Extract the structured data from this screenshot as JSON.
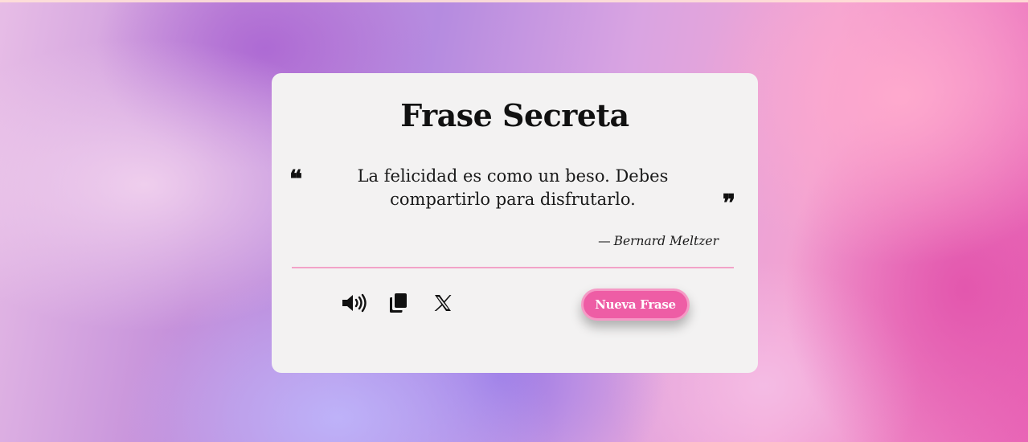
{
  "card": {
    "title": "Frase Secreta",
    "quote_open": "❝",
    "quote_text": "La felicidad es como un beso. Debes compartirlo para disfrutarlo.",
    "quote_close": "❞",
    "author_dash": "—",
    "author": "Bernard Meltzer"
  },
  "actions": {
    "icons": [
      "speaker-icon",
      "copy-icon",
      "x-logo-icon"
    ],
    "new_quote_label": "Nueva Frase"
  },
  "colors": {
    "accent": "#ee5da5",
    "divider": "#f2a3c8",
    "card_bg": "#f3f2f2"
  }
}
